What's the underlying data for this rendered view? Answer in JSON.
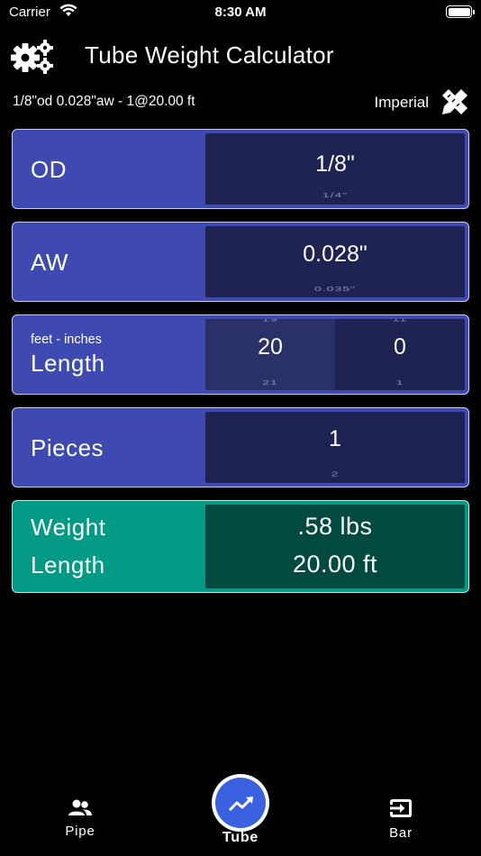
{
  "status_bar": {
    "carrier": "Carrier",
    "time": "8:30 AM"
  },
  "header": {
    "title": "Tube Weight Calculator",
    "settings_icon": "gears-icon"
  },
  "summary": {
    "text": "1/8\"od 0.028\"aw - 1@20.00 ft",
    "units": "Imperial",
    "units_icon": "ruler-pencil-icon"
  },
  "rows": {
    "od": {
      "label": "OD",
      "value": "1/8\"",
      "next": "1/4\""
    },
    "aw": {
      "label": "AW",
      "value": "0.028\"",
      "next": "0.035\""
    },
    "length": {
      "sublabel": "feet - inches",
      "label": "Length",
      "feet": {
        "prev": "19",
        "value": "20",
        "next": "21"
      },
      "inches": {
        "prev": "11",
        "value": "0",
        "next": "1"
      }
    },
    "pieces": {
      "label": "Pieces",
      "value": "1",
      "next": "2"
    },
    "result": {
      "weight_label": "Weight",
      "length_label": "Length",
      "weight_value": ".58  lbs",
      "length_value": "20.00  ft"
    }
  },
  "tabs": {
    "pipe": {
      "label": "Pipe",
      "icon": "people-icon"
    },
    "tube": {
      "label": "Tube",
      "icon": "trending-up-icon",
      "selected": true
    },
    "bar": {
      "label": "Bar",
      "icon": "exit-icon"
    }
  },
  "colors": {
    "row_bg": "#3e4ab1",
    "panel_bg": "#1e2352",
    "result_bg": "#009a85",
    "result_panel": "#004a40",
    "tab_accent": "#3a62e0"
  }
}
